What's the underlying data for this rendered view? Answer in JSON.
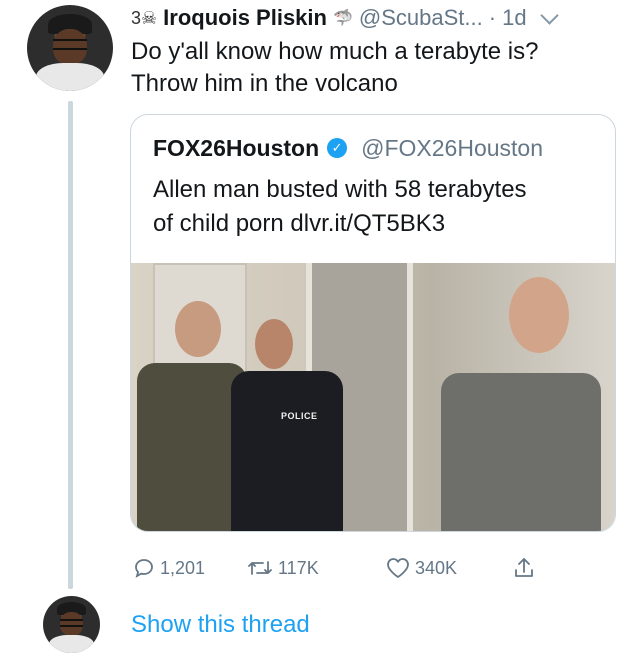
{
  "tweet": {
    "emoji": "3☠",
    "author_name": "Iroquois Pliskin",
    "author_emoji": "🦈",
    "handle": "@ScubaSt...",
    "time": "· 1d",
    "text_lines": [
      "Do y'all know how much a terabyte is?",
      "Throw him in the volcano"
    ]
  },
  "quote": {
    "name": "FOX26Houston",
    "handle": "@FOX26Houston",
    "text_lines": [
      "Allen man busted with 58 terabytes",
      "of child porn dlvr.it/QT5BK3"
    ],
    "photo_badge": "POLICE"
  },
  "actions": {
    "replies": "1,201",
    "retweets": "117K",
    "likes": "340K"
  },
  "thread": {
    "show_label": "Show this thread"
  },
  "icons": {
    "reply": "reply-icon",
    "retweet": "retweet-icon",
    "like": "heart-icon",
    "share": "share-icon",
    "verified": "verified-badge-icon",
    "menu": "chevron-down-icon"
  },
  "colors": {
    "accent": "#1da1f2",
    "muted": "#657786",
    "border": "#ccd6dd"
  }
}
